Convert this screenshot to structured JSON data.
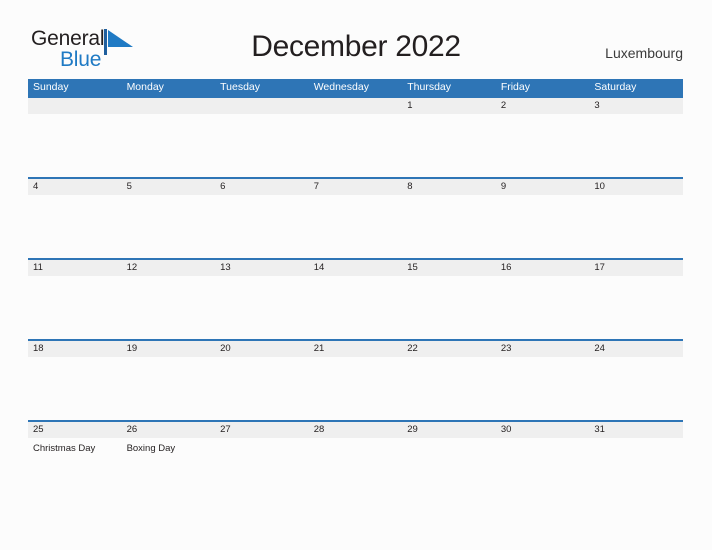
{
  "brand": {
    "name_part1": "General",
    "name_part2": "Blue",
    "mark_icon": "triangle-flag-icon",
    "accent_color": "#1f7ac4"
  },
  "header": {
    "title": "December 2022",
    "country": "Luxembourg"
  },
  "colors": {
    "header_blue": "#2e75b6",
    "date_band_gray": "#efefef",
    "page_background": "#fcfcfc",
    "text": "#231f20"
  },
  "calendar": {
    "weekdays": [
      "Sunday",
      "Monday",
      "Tuesday",
      "Wednesday",
      "Thursday",
      "Friday",
      "Saturday"
    ],
    "weeks": [
      {
        "days": [
          {
            "date": "",
            "event": ""
          },
          {
            "date": "",
            "event": ""
          },
          {
            "date": "",
            "event": ""
          },
          {
            "date": "",
            "event": ""
          },
          {
            "date": "1",
            "event": ""
          },
          {
            "date": "2",
            "event": ""
          },
          {
            "date": "3",
            "event": ""
          }
        ]
      },
      {
        "days": [
          {
            "date": "4",
            "event": ""
          },
          {
            "date": "5",
            "event": ""
          },
          {
            "date": "6",
            "event": ""
          },
          {
            "date": "7",
            "event": ""
          },
          {
            "date": "8",
            "event": ""
          },
          {
            "date": "9",
            "event": ""
          },
          {
            "date": "10",
            "event": ""
          }
        ]
      },
      {
        "days": [
          {
            "date": "11",
            "event": ""
          },
          {
            "date": "12",
            "event": ""
          },
          {
            "date": "13",
            "event": ""
          },
          {
            "date": "14",
            "event": ""
          },
          {
            "date": "15",
            "event": ""
          },
          {
            "date": "16",
            "event": ""
          },
          {
            "date": "17",
            "event": ""
          }
        ]
      },
      {
        "days": [
          {
            "date": "18",
            "event": ""
          },
          {
            "date": "19",
            "event": ""
          },
          {
            "date": "20",
            "event": ""
          },
          {
            "date": "21",
            "event": ""
          },
          {
            "date": "22",
            "event": ""
          },
          {
            "date": "23",
            "event": ""
          },
          {
            "date": "24",
            "event": ""
          }
        ]
      },
      {
        "days": [
          {
            "date": "25",
            "event": "Christmas Day"
          },
          {
            "date": "26",
            "event": "Boxing Day"
          },
          {
            "date": "27",
            "event": ""
          },
          {
            "date": "28",
            "event": ""
          },
          {
            "date": "29",
            "event": ""
          },
          {
            "date": "30",
            "event": ""
          },
          {
            "date": "31",
            "event": ""
          }
        ]
      }
    ]
  }
}
